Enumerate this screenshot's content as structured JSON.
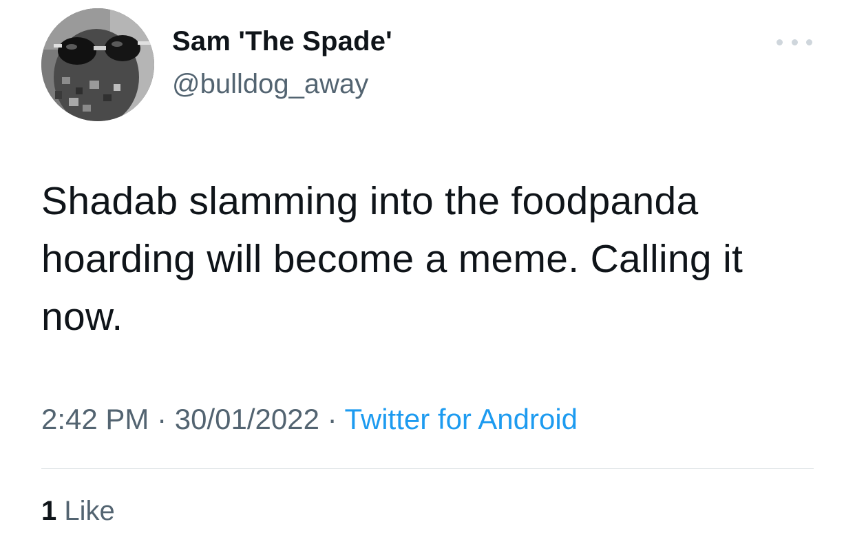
{
  "author": {
    "display_name": "Sam 'The Spade'",
    "handle": "@bulldog_away",
    "avatar_icon": "profile-photo-sunglasses"
  },
  "tweet": {
    "text": "Shadab slamming into the foodpanda hoarding will become a meme. Calling it now."
  },
  "meta": {
    "time": "2:42 PM",
    "separator1": " · ",
    "date": "30/01/2022",
    "separator2": " · ",
    "source": "Twitter for Android"
  },
  "engagement": {
    "likes_count": "1",
    "likes_label": "Like"
  },
  "colors": {
    "text_primary": "#0f1419",
    "text_secondary": "#536471",
    "link_blue": "#1d9bf0",
    "divider": "#dfe3e6"
  }
}
